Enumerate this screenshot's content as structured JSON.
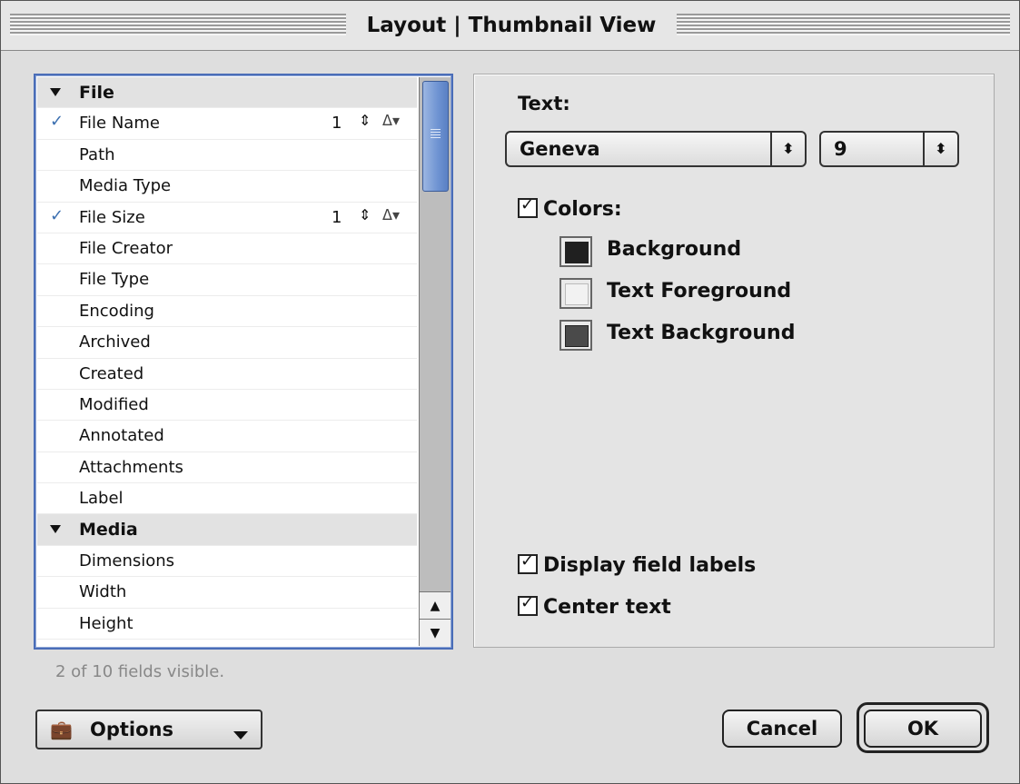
{
  "window": {
    "title": "Layout | Thumbnail View"
  },
  "field_list": {
    "groups": [
      {
        "name": "File",
        "items": [
          {
            "label": "File Name",
            "checked": true,
            "count": "1"
          },
          {
            "label": "Path"
          },
          {
            "label": "Media Type"
          },
          {
            "label": "File Size",
            "checked": true,
            "count": "1"
          },
          {
            "label": "File Creator"
          },
          {
            "label": "File Type"
          },
          {
            "label": "Encoding"
          },
          {
            "label": "Archived"
          },
          {
            "label": "Created"
          },
          {
            "label": "Modified"
          },
          {
            "label": "Annotated"
          },
          {
            "label": "Attachments"
          },
          {
            "label": "Label"
          }
        ]
      },
      {
        "name": "Media",
        "items": [
          {
            "label": "Dimensions"
          },
          {
            "label": "Width"
          },
          {
            "label": "Height"
          }
        ]
      }
    ],
    "status": "2 of 10 fields visible."
  },
  "text_settings": {
    "label": "Text:",
    "font": "Geneva",
    "size": "9"
  },
  "colors": {
    "label": "Colors:",
    "checked": true,
    "swatches": [
      {
        "label": "Background",
        "color": "#202020"
      },
      {
        "label": "Text Foreground",
        "color": "#f2f2f2"
      },
      {
        "label": "Text Background",
        "color": "#4a4a4a"
      }
    ]
  },
  "options": {
    "display_field_labels": {
      "label": "Display field labels",
      "checked": true
    },
    "center_text": {
      "label": "Center text",
      "checked": true
    }
  },
  "buttons": {
    "options": "Options",
    "cancel": "Cancel",
    "ok": "OK"
  },
  "icons": {
    "disclosure": "disclosure-triangle-icon",
    "check": "checkmark-icon",
    "stepper": "up-down-stepper-icon",
    "style": "text-style-icon",
    "briefcase": "briefcase-icon"
  }
}
